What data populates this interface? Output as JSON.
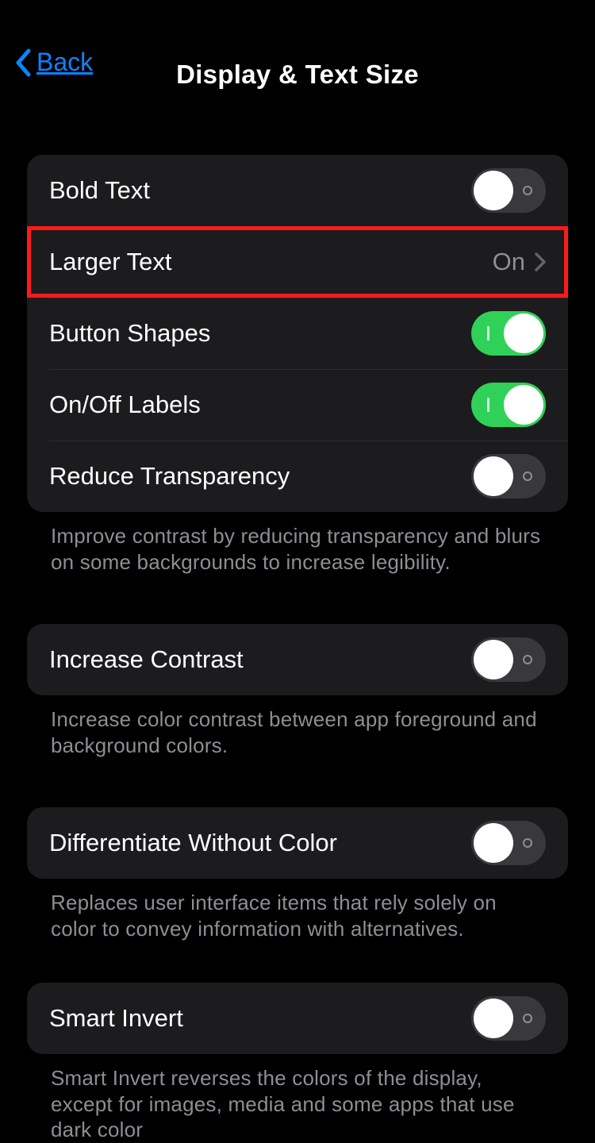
{
  "header": {
    "back_label": "Back",
    "title": "Display & Text Size"
  },
  "group1": {
    "bold_text": "Bold Text",
    "larger_text": "Larger Text",
    "larger_text_value": "On",
    "button_shapes": "Button Shapes",
    "onoff_labels": "On/Off Labels",
    "reduce_transparency": "Reduce Transparency",
    "footer": "Improve contrast by reducing transparency and blurs on some backgrounds to increase legibility."
  },
  "group2": {
    "increase_contrast": "Increase Contrast",
    "footer": "Increase color contrast between app foreground and background colors."
  },
  "group3": {
    "diff_without_color": "Differentiate Without Color",
    "footer": "Replaces user interface items that rely solely on color to convey information with alternatives."
  },
  "group4": {
    "smart_invert": "Smart Invert",
    "footer": "Smart Invert reverses the colors of the display, except for images, media and some apps that use dark color"
  }
}
